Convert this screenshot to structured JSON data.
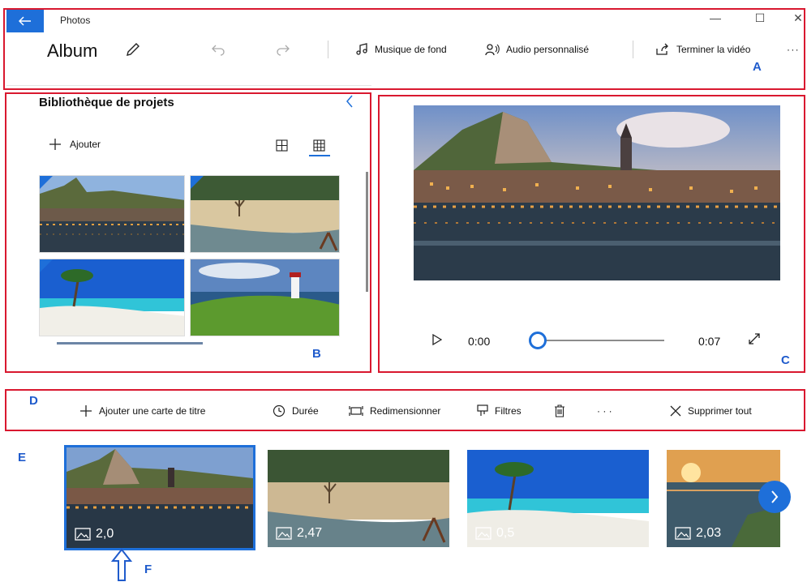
{
  "app": {
    "title": "Photos"
  },
  "toolbar": {
    "album_title": "Album",
    "music_label": "Musique de fond",
    "audio_label": "Audio personnalisé",
    "finish_label": "Terminer la vidéo",
    "more_label": "· · ·"
  },
  "library": {
    "title": "Bibliothèque de projets",
    "add_label": "Ajouter"
  },
  "player": {
    "current_time": "0:00",
    "total_time": "0:07",
    "progress": 0
  },
  "storyboard_toolbar": {
    "add_title_card": "Ajouter une carte de titre",
    "duration": "Durée",
    "resize": "Redimensionner",
    "filters": "Filtres",
    "more": "· · ·",
    "delete_all": "Supprimer tout"
  },
  "storyboard": {
    "cards": [
      {
        "duration": "2,0",
        "selected": true
      },
      {
        "duration": "2,47",
        "selected": false
      },
      {
        "duration": "0,5",
        "selected": false
      },
      {
        "duration": "2,03",
        "selected": false
      }
    ]
  },
  "annotations": {
    "a": "A",
    "b": "B",
    "c": "C",
    "d": "D",
    "e": "E",
    "f": "F"
  },
  "colors": {
    "accent": "#1e6fd9",
    "highlight_frame": "#d9182f",
    "annotation_letter": "#1f5bcc"
  },
  "icons": {
    "back": "back-arrow-icon",
    "edit": "pencil-icon",
    "undo": "undo-icon",
    "redo": "redo-icon",
    "music": "music-note-icon",
    "audio": "audio-person-icon",
    "finish": "export-icon",
    "add": "plus-icon",
    "grid_large": "grid-large-icon",
    "grid_small": "grid-small-icon",
    "play": "play-icon",
    "fullscreen": "expand-icon",
    "duration": "clock-icon",
    "resize": "resize-icon",
    "filters": "filter-icon",
    "trash": "trash-icon",
    "close": "close-icon",
    "next": "chevron-right-icon",
    "image": "image-icon"
  }
}
